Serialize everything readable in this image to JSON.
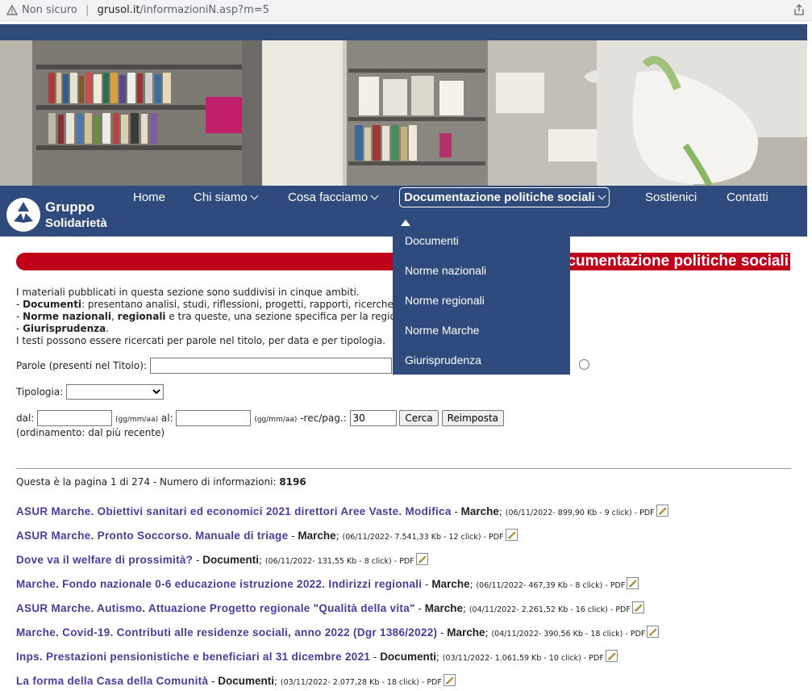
{
  "browser": {
    "security": "Non sicuro",
    "url_domain": "grusol.it",
    "url_path": "/informazioniN.asp?m=5"
  },
  "nav": {
    "logo_line1": "Gruppo",
    "logo_line2": "Solidarietà",
    "items": [
      {
        "label": "Home"
      },
      {
        "label": "Chi siamo"
      },
      {
        "label": "Cosa facciamo"
      },
      {
        "label": "Documentazione politiche sociali"
      },
      {
        "label": "Sostienici"
      },
      {
        "label": "Contatti"
      }
    ]
  },
  "dropdown": {
    "items": [
      {
        "label": "Documenti"
      },
      {
        "label": "Norme nazionali"
      },
      {
        "label": "Norme regionali"
      },
      {
        "label": "Norme Marche"
      },
      {
        "label": "Giurisprudenza"
      }
    ]
  },
  "banner": {
    "title": "Documentazione politiche sociali",
    "visible_title": "nentazione politiche sociali"
  },
  "intro": {
    "line1": "I materiali pubblicati in questa sezione sono suddivisi in cinque ambiti.",
    "line2_bold": "Documenti",
    "line2_rest": ": presentano analisi, studi, riflessioni, progetti, rapporti, ricerche",
    "line3_bold1": "Norme nazionali",
    "line3_sep": ", ",
    "line3_bold2": "regionali",
    "line3_rest": " e tra queste, una sezione specifica per la regione",
    "line4_bold": "Giurisprudenza",
    "line5": "I testi possono essere ricercati per parole nel titolo, per data e  per tipologia."
  },
  "search": {
    "words_label": "Parole (presenti nel Titolo):",
    "words_value": "",
    "type_label": "Tipologia:",
    "type_value": "",
    "from_label": "dal:",
    "date_hint": "(gg/mm/aa)",
    "to_label": "al:",
    "rec_label": "-rec/pag.:",
    "rec_value": "30",
    "search_button": "Cerca",
    "reset_button": "Reimposta",
    "order_note": "(ordinamento: dal più recente)"
  },
  "pageinfo": {
    "text": "Questa è la pagina 1 di 274 - Numero di informazioni: ",
    "count": "8196"
  },
  "results": [
    {
      "title": "ASUR Marche. Obiettivi sanitari ed economici 2021 direttori Aree Vaste. Modifica",
      "category": "Marche",
      "meta": "(06/11/2022- 899,90 Kb - 9 click) - PDF"
    },
    {
      "title": "ASUR Marche. Pronto Soccorso. Manuale di triage",
      "category": "Marche",
      "meta": "(06/11/2022- 7.541,33 Kb - 12 click) - PDF"
    },
    {
      "title": "Dove va il welfare di prossimità?",
      "category": "Documenti",
      "meta": "(06/11/2022- 131,55 Kb - 8 click) - PDF"
    },
    {
      "title": "Marche. Fondo nazionale 0-6 educazione istruzione 2022. Indirizzi regionali",
      "category": "Marche",
      "meta": "(06/11/2022- 467,39 Kb - 8 click) - PDF"
    },
    {
      "title": "ASUR Marche. Autismo. Attuazione Progetto regionale \"Qualità della vita\"",
      "category": "Marche",
      "meta": "(04/11/2022- 2.261,52 Kb - 16 click) - PDF"
    },
    {
      "title": "Marche. Covid-19. Contributi alle residenze sociali, anno 2022 (Dgr 1386/2022)",
      "category": "Marche",
      "meta": "(04/11/2022- 390,56 Kb - 18 click) - PDF"
    },
    {
      "title": "Inps. Prestazioni pensionistiche e beneficiari al 31 dicembre 2021",
      "category": "Documenti",
      "meta": "(03/11/2022- 1.061,59 Kb - 10 click) - PDF"
    },
    {
      "title": "La forma della Casa della Comunità",
      "category": "Documenti",
      "meta": "(03/11/2022- 2.077,28 Kb - 18 click) - PDF"
    }
  ],
  "colors": {
    "nav_bg": "#2f4a7c",
    "banner_red": "#c0001a",
    "link": "#4a3ba0"
  }
}
